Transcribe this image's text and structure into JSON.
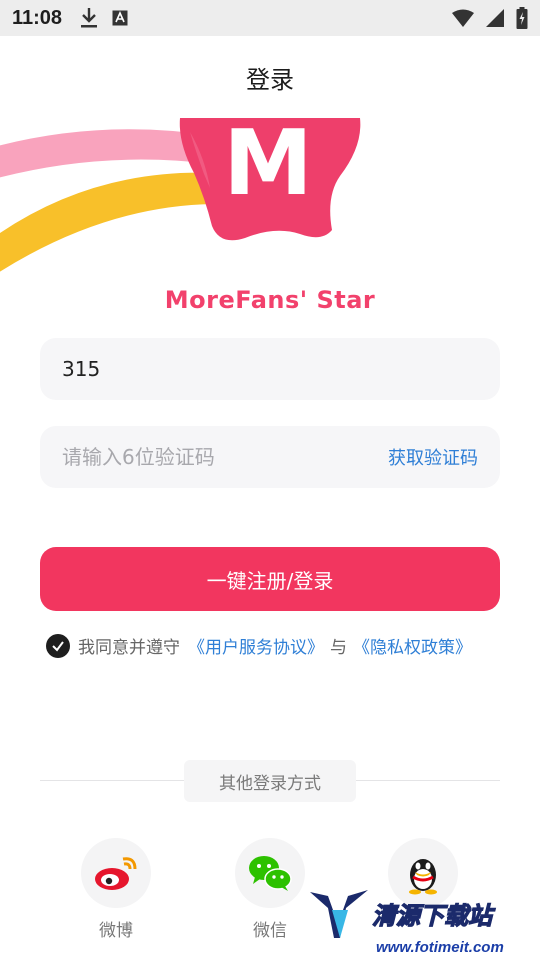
{
  "status_bar": {
    "time": "11:08"
  },
  "header": {
    "title": "登录"
  },
  "brand": {
    "logo_letter": "M",
    "name": "MoreFans' Star"
  },
  "form": {
    "phone_value": "315",
    "code_placeholder": "请输入6位验证码",
    "get_code_label": "获取验证码",
    "submit_label": "一键注册/登录"
  },
  "agreement": {
    "prefix": "我同意并遵守",
    "user_agreement": "《用户服务协议》",
    "and": "与",
    "privacy_policy": "《隐私权政策》",
    "checked": true
  },
  "other_login": {
    "label": "其他登录方式",
    "options": [
      {
        "label": "微博",
        "icon": "weibo-icon"
      },
      {
        "label": "微信",
        "icon": "wechat-icon"
      },
      {
        "label": "",
        "icon": "qq-icon"
      }
    ]
  },
  "watermark": {
    "text": "清源下载站",
    "url": "www.fotimeit.com"
  },
  "colors": {
    "accent": "#f2365f",
    "link": "#2f7fd6",
    "brand_text": "#f2416c"
  }
}
